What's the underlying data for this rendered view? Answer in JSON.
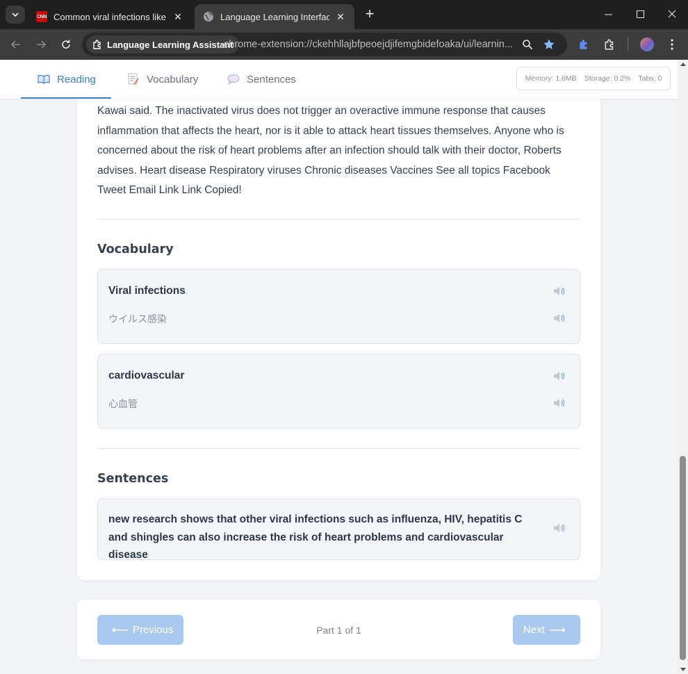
{
  "browser": {
    "tabs": [
      {
        "title": "Common viral infections like flu",
        "favicon": "cnn-logo-icon",
        "favicon_text": "CNN",
        "active": false
      },
      {
        "title": "Language Learning Interface",
        "favicon": "globe-icon",
        "active": true
      }
    ],
    "site_chip": "Language Learning Assistant",
    "url": "chrome-extension://ckehhllajbfpeoejdjifemgbidefoaka/ui/learnin..."
  },
  "nav": {
    "tabs": [
      {
        "label": "Reading",
        "icon": "open-book-icon",
        "active": true
      },
      {
        "label": "Vocabulary",
        "icon": "memo-icon",
        "active": false
      },
      {
        "label": "Sentences",
        "icon": "speech-bubble-icon",
        "active": false
      }
    ],
    "stats": {
      "memory": "Memory: 1.6MB",
      "storage": "Storage: 0.2%",
      "tabs": "Tabs: 0"
    }
  },
  "reading": {
    "text": "Kawai said. The inactivated virus does not trigger an overactive immune response that causes inflammation that affects the heart, nor is it able to attack heart tissues themselves. Anyone who is concerned about the risk of heart problems after an infection should talk with their doctor, Roberts advises. Heart disease Respiratory viruses Chronic diseases Vaccines See all topics Facebook Tweet Email Link Link Copied!"
  },
  "vocabulary": {
    "title": "Vocabulary",
    "items": [
      {
        "word": "Viral infections",
        "translation": "ウイルス感染"
      },
      {
        "word": "cardiovascular",
        "translation": "心血管"
      }
    ]
  },
  "sentences": {
    "title": "Sentences",
    "items": [
      {
        "text": "new research shows that other viral infections such as influenza, HIV, hepatitis C and shingles can also increase the risk of heart problems and cardiovascular disease"
      }
    ]
  },
  "pagination": {
    "prev_label": "Previous",
    "next_label": "Next",
    "info": "Part 1 of 1"
  },
  "colors": {
    "accent": "#3b82c4",
    "button_disabled": "#a9c9ee",
    "page_bg": "#f3f4f7"
  }
}
